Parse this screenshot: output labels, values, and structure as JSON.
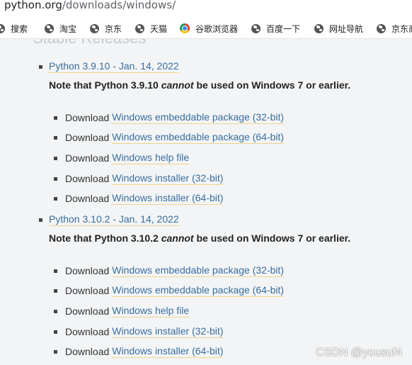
{
  "address_bar": {
    "host": "python.org",
    "path": "/downloads/windows/"
  },
  "bookmarks": [
    {
      "label": "搜索",
      "icon": "globe-icon"
    },
    {
      "label": "淘宝",
      "icon": "globe-icon"
    },
    {
      "label": "京东",
      "icon": "globe-icon"
    },
    {
      "label": "天猫",
      "icon": "globe-icon"
    },
    {
      "label": "谷歌浏览器",
      "icon": "chrome-icon"
    },
    {
      "label": "百度一下",
      "icon": "globe-icon"
    },
    {
      "label": "网址导航",
      "icon": "globe-icon"
    },
    {
      "label": "京东商",
      "icon": "globe-icon"
    }
  ],
  "page": {
    "section_heading": "Stable Releases",
    "releases": [
      {
        "link": "Python 3.9.10 - Jan. 14, 2022",
        "note_before": "Note that Python 3.9.10 ",
        "note_em": "cannot",
        "note_after": " be used on Windows 7 or earlier.",
        "downloads": [
          {
            "prefix": "Download",
            "link": "Windows embeddable package (32-bit)"
          },
          {
            "prefix": "Download",
            "link": "Windows embeddable package (64-bit)"
          },
          {
            "prefix": "Download",
            "link": "Windows help file"
          },
          {
            "prefix": "Download",
            "link": "Windows installer (32-bit)"
          },
          {
            "prefix": "Download",
            "link": "Windows installer (64-bit)"
          }
        ]
      },
      {
        "link": "Python 3.10.2 - Jan. 14, 2022",
        "note_before": "Note that Python 3.10.2 ",
        "note_em": "cannot",
        "note_after": " be used on Windows 7 or earlier.",
        "downloads": [
          {
            "prefix": "Download",
            "link": "Windows embeddable package (32-bit)"
          },
          {
            "prefix": "Download",
            "link": "Windows embeddable package (64-bit)"
          },
          {
            "prefix": "Download",
            "link": "Windows help file"
          },
          {
            "prefix": "Download",
            "link": "Windows installer (32-bit)"
          },
          {
            "prefix": "Download",
            "link": "Windows installer (64-bit)"
          }
        ]
      }
    ]
  },
  "watermark": "CSDN @yousuf4",
  "colors": {
    "link": "#3b6e9d",
    "link_underline": "#f1d48a",
    "content_background": "#f2f4f6"
  }
}
